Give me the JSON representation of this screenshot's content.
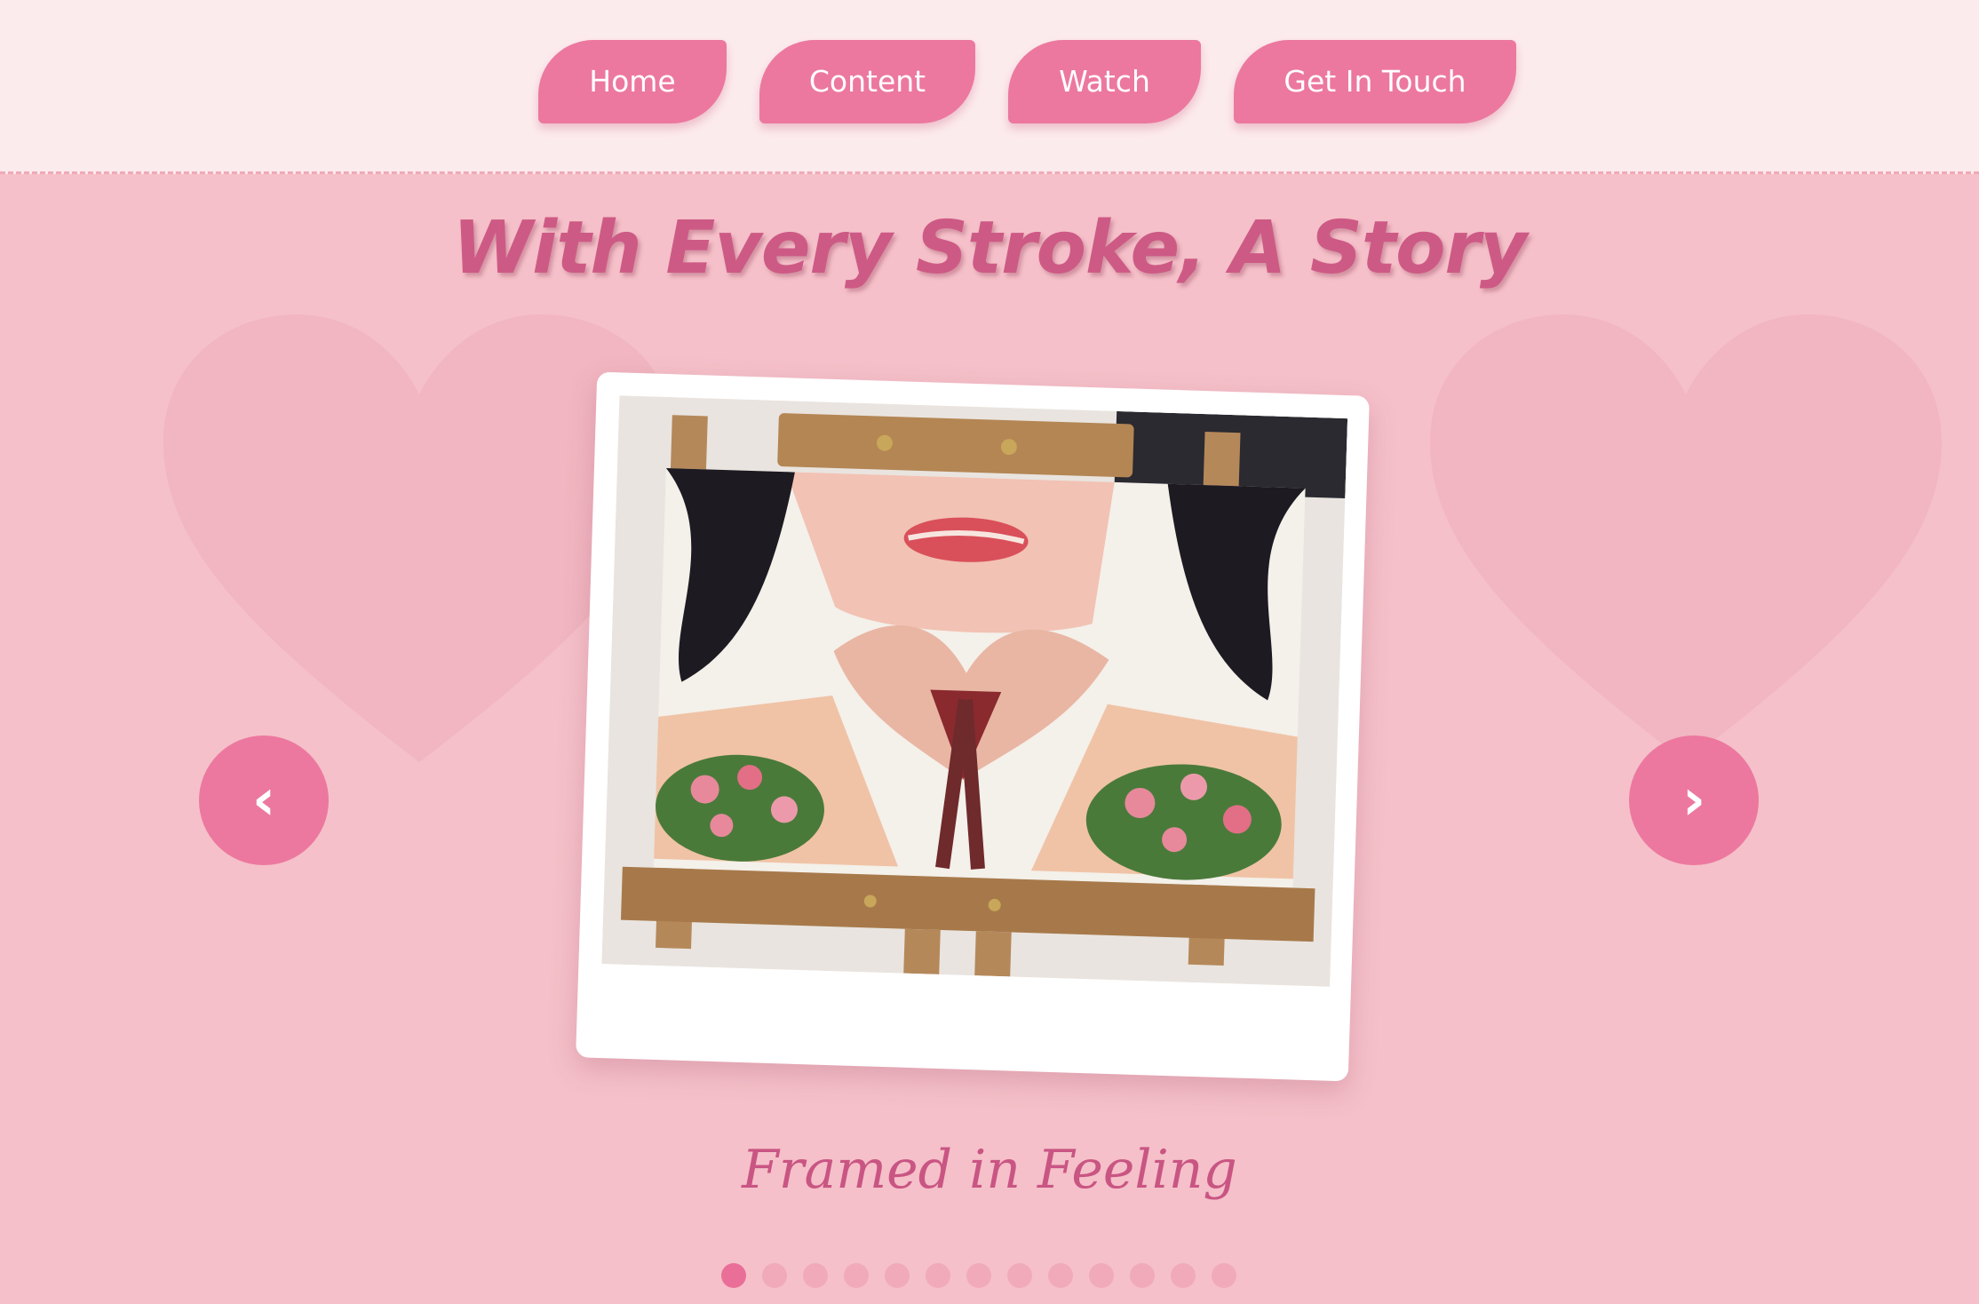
{
  "nav": {
    "home": "Home",
    "content": "Content",
    "watch": "Watch",
    "contact": "Get In Touch"
  },
  "hero": {
    "title": "With Every Stroke, A Story"
  },
  "carousel": {
    "prev_icon": "‹",
    "next_icon": "›",
    "caption": "Framed in Feeling",
    "slide_count": 13,
    "active_index": 0
  },
  "colors": {
    "accent": "#ec789f",
    "background": "#f5c0c9",
    "header_bg": "#fcebed",
    "title": "#cd5a85"
  }
}
